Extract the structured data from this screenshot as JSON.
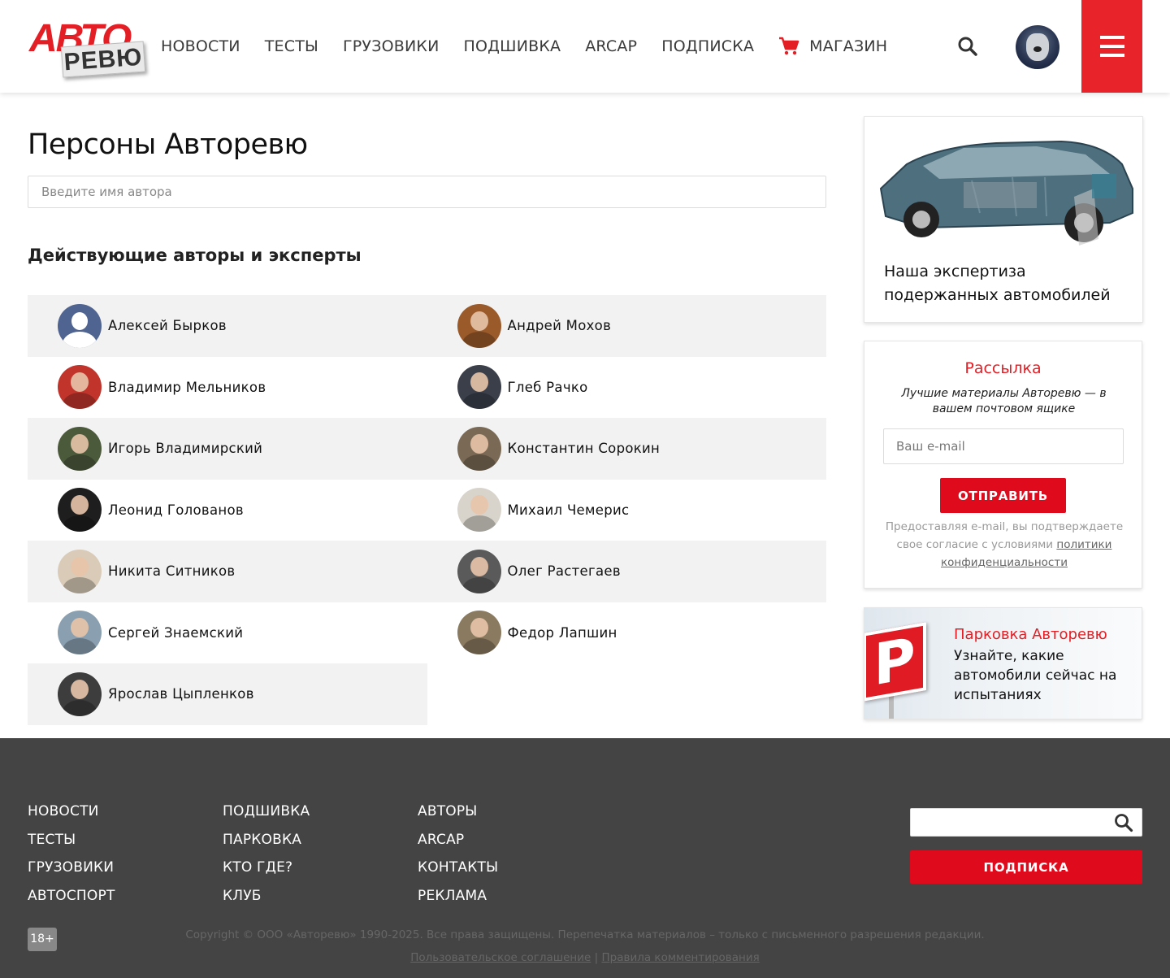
{
  "header": {
    "logo_top": "АВТО",
    "logo_bottom": "РЕВЮ",
    "nav": [
      "НОВОСТИ",
      "ТЕСТЫ",
      "ГРУЗОВИКИ",
      "ПОДШИВКА",
      "ARCAP",
      "ПОДПИСКА"
    ],
    "shop_label": "МАГАЗИН",
    "accent_color": "#e8232a"
  },
  "main": {
    "title": "Персоны Авторевю",
    "search_placeholder": "Введите имя автора",
    "section_title": "Действующие авторы и эксперты",
    "authors": [
      "Алексей Бырков",
      "Андрей Мохов",
      "Владимир Мельников",
      "Глеб Рачко",
      "Игорь Владимирский",
      "Константин Сорокин",
      "Леонид Голованов",
      "Михаил Чемерис",
      "Никита Ситников",
      "Олег Растегаев",
      "Сергей Знаемский",
      "Федор Лапшин",
      "Ярослав Цыпленков"
    ]
  },
  "sidebar": {
    "expert_text": "Наша экспертиза подержанных автомобилей",
    "newsletter": {
      "title": "Рассылка",
      "subtitle": "Лучшие материалы Авторевю — в вашем почтовом ящике",
      "email_placeholder": "Ваш e-mail",
      "button": "ОТПРАВИТЬ",
      "note": "Предоставляя e-mail, вы подтверждаете свое согласие с условиями",
      "note_link": "политики конфиденциальности"
    },
    "parking": {
      "sign_letter": "P",
      "title": "Парковка Авторевю",
      "text": "Узнайте, какие автомобили сейчас на испытаниях"
    }
  },
  "footer": {
    "col1": [
      "НОВОСТИ",
      "ТЕСТЫ",
      "ГРУЗОВИКИ",
      "АВТОСПОРТ"
    ],
    "col2": [
      "ПОДШИВКА",
      "ПАРКОВКА",
      "КТО ГДЕ?",
      "КЛУБ"
    ],
    "col3": [
      "АВТОРЫ",
      "ARCAP",
      "КОНТАКТЫ",
      "РЕКЛАМА"
    ],
    "subscribe": "ПОДПИСКА",
    "age": "18+",
    "copyright": "Copyright © ООО «Авторевю» 1990-2025. Все права защищены. Перепечатка материалов – только с письменного разрешения редакции.",
    "user_agreement": "Пользовательское соглашение",
    "separator": "|",
    "comment_rules": "Правила комментирования"
  }
}
